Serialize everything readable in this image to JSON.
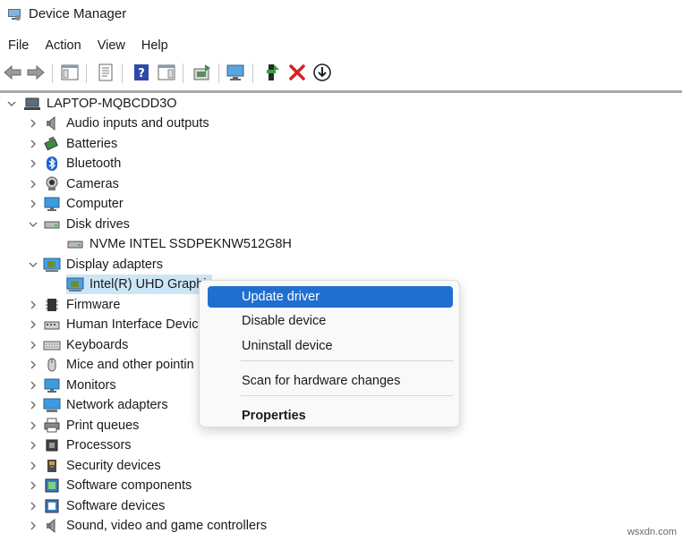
{
  "window": {
    "title": "Device Manager"
  },
  "menu": [
    "File",
    "Action",
    "View",
    "Help"
  ],
  "toolbar": {
    "buttons": [
      "back-icon",
      "forward-icon",
      "show-hide-console-tree-icon",
      "properties-icon",
      "help-icon",
      "action-pane-icon",
      "update-driver-icon",
      "scan-hardware-icon",
      "enable-device-icon",
      "uninstall-icon",
      "download-icon"
    ]
  },
  "tree": {
    "root": "LAPTOP-MQBCDD3O",
    "items": [
      {
        "label": "Audio inputs and outputs",
        "icon": "speaker-icon",
        "expanded": false
      },
      {
        "label": "Batteries",
        "icon": "battery-icon",
        "expanded": false
      },
      {
        "label": "Bluetooth",
        "icon": "bluetooth-icon",
        "expanded": false
      },
      {
        "label": "Cameras",
        "icon": "camera-icon",
        "expanded": false
      },
      {
        "label": "Computer",
        "icon": "monitor-icon",
        "expanded": false
      },
      {
        "label": "Disk drives",
        "icon": "disk-icon",
        "expanded": true
      },
      {
        "label": "NVMe INTEL SSDPEKNW512G8H",
        "icon": "disk-icon",
        "child": true
      },
      {
        "label": "Display adapters",
        "icon": "display-adapter-icon",
        "expanded": true
      },
      {
        "label": "Intel(R) UHD Graphi",
        "icon": "display-adapter-icon",
        "child": true,
        "selected": true
      },
      {
        "label": "Firmware",
        "icon": "firmware-icon",
        "expanded": false
      },
      {
        "label": "Human Interface Devic",
        "icon": "hid-icon",
        "expanded": false
      },
      {
        "label": "Keyboards",
        "icon": "keyboard-icon",
        "expanded": false
      },
      {
        "label": "Mice and other pointin",
        "icon": "mouse-icon",
        "expanded": false
      },
      {
        "label": "Monitors",
        "icon": "monitor-icon",
        "expanded": false
      },
      {
        "label": "Network adapters",
        "icon": "network-icon",
        "expanded": false
      },
      {
        "label": "Print queues",
        "icon": "printer-icon",
        "expanded": false
      },
      {
        "label": "Processors",
        "icon": "processor-icon",
        "expanded": false
      },
      {
        "label": "Security devices",
        "icon": "security-icon",
        "expanded": false
      },
      {
        "label": "Software components",
        "icon": "software-component-icon",
        "expanded": false
      },
      {
        "label": "Software devices",
        "icon": "software-device-icon",
        "expanded": false
      },
      {
        "label": "Sound, video and game controllers",
        "icon": "speaker-icon",
        "expanded": false
      }
    ]
  },
  "context_menu": {
    "items": [
      {
        "label": "Update driver",
        "active": true
      },
      {
        "label": "Disable device"
      },
      {
        "label": "Uninstall device"
      },
      {
        "label": "Scan for hardware changes"
      },
      {
        "label": "Properties",
        "bold": true
      }
    ]
  },
  "watermark": "wsxdn.com",
  "colors": {
    "selection": "#cde6f7",
    "menu_highlight": "#1f6fd0"
  }
}
